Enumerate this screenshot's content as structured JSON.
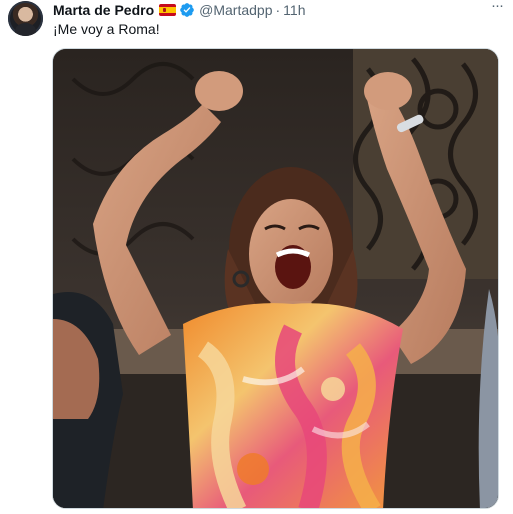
{
  "tweet": {
    "author_name": "Marta de Pedro",
    "handle": "@Martadpp",
    "separator": "·",
    "time": "11h",
    "text": "¡Me voy a Roma!",
    "more_label": "···"
  },
  "icons": {
    "avatar": "profile-avatar",
    "flag": "spain-flag-emoji",
    "verified": "verified-badge-icon",
    "more": "more-options-icon"
  },
  "colors": {
    "verified": "#1d9bf0",
    "secondary_text": "#536471",
    "primary_text": "#0f1419"
  }
}
